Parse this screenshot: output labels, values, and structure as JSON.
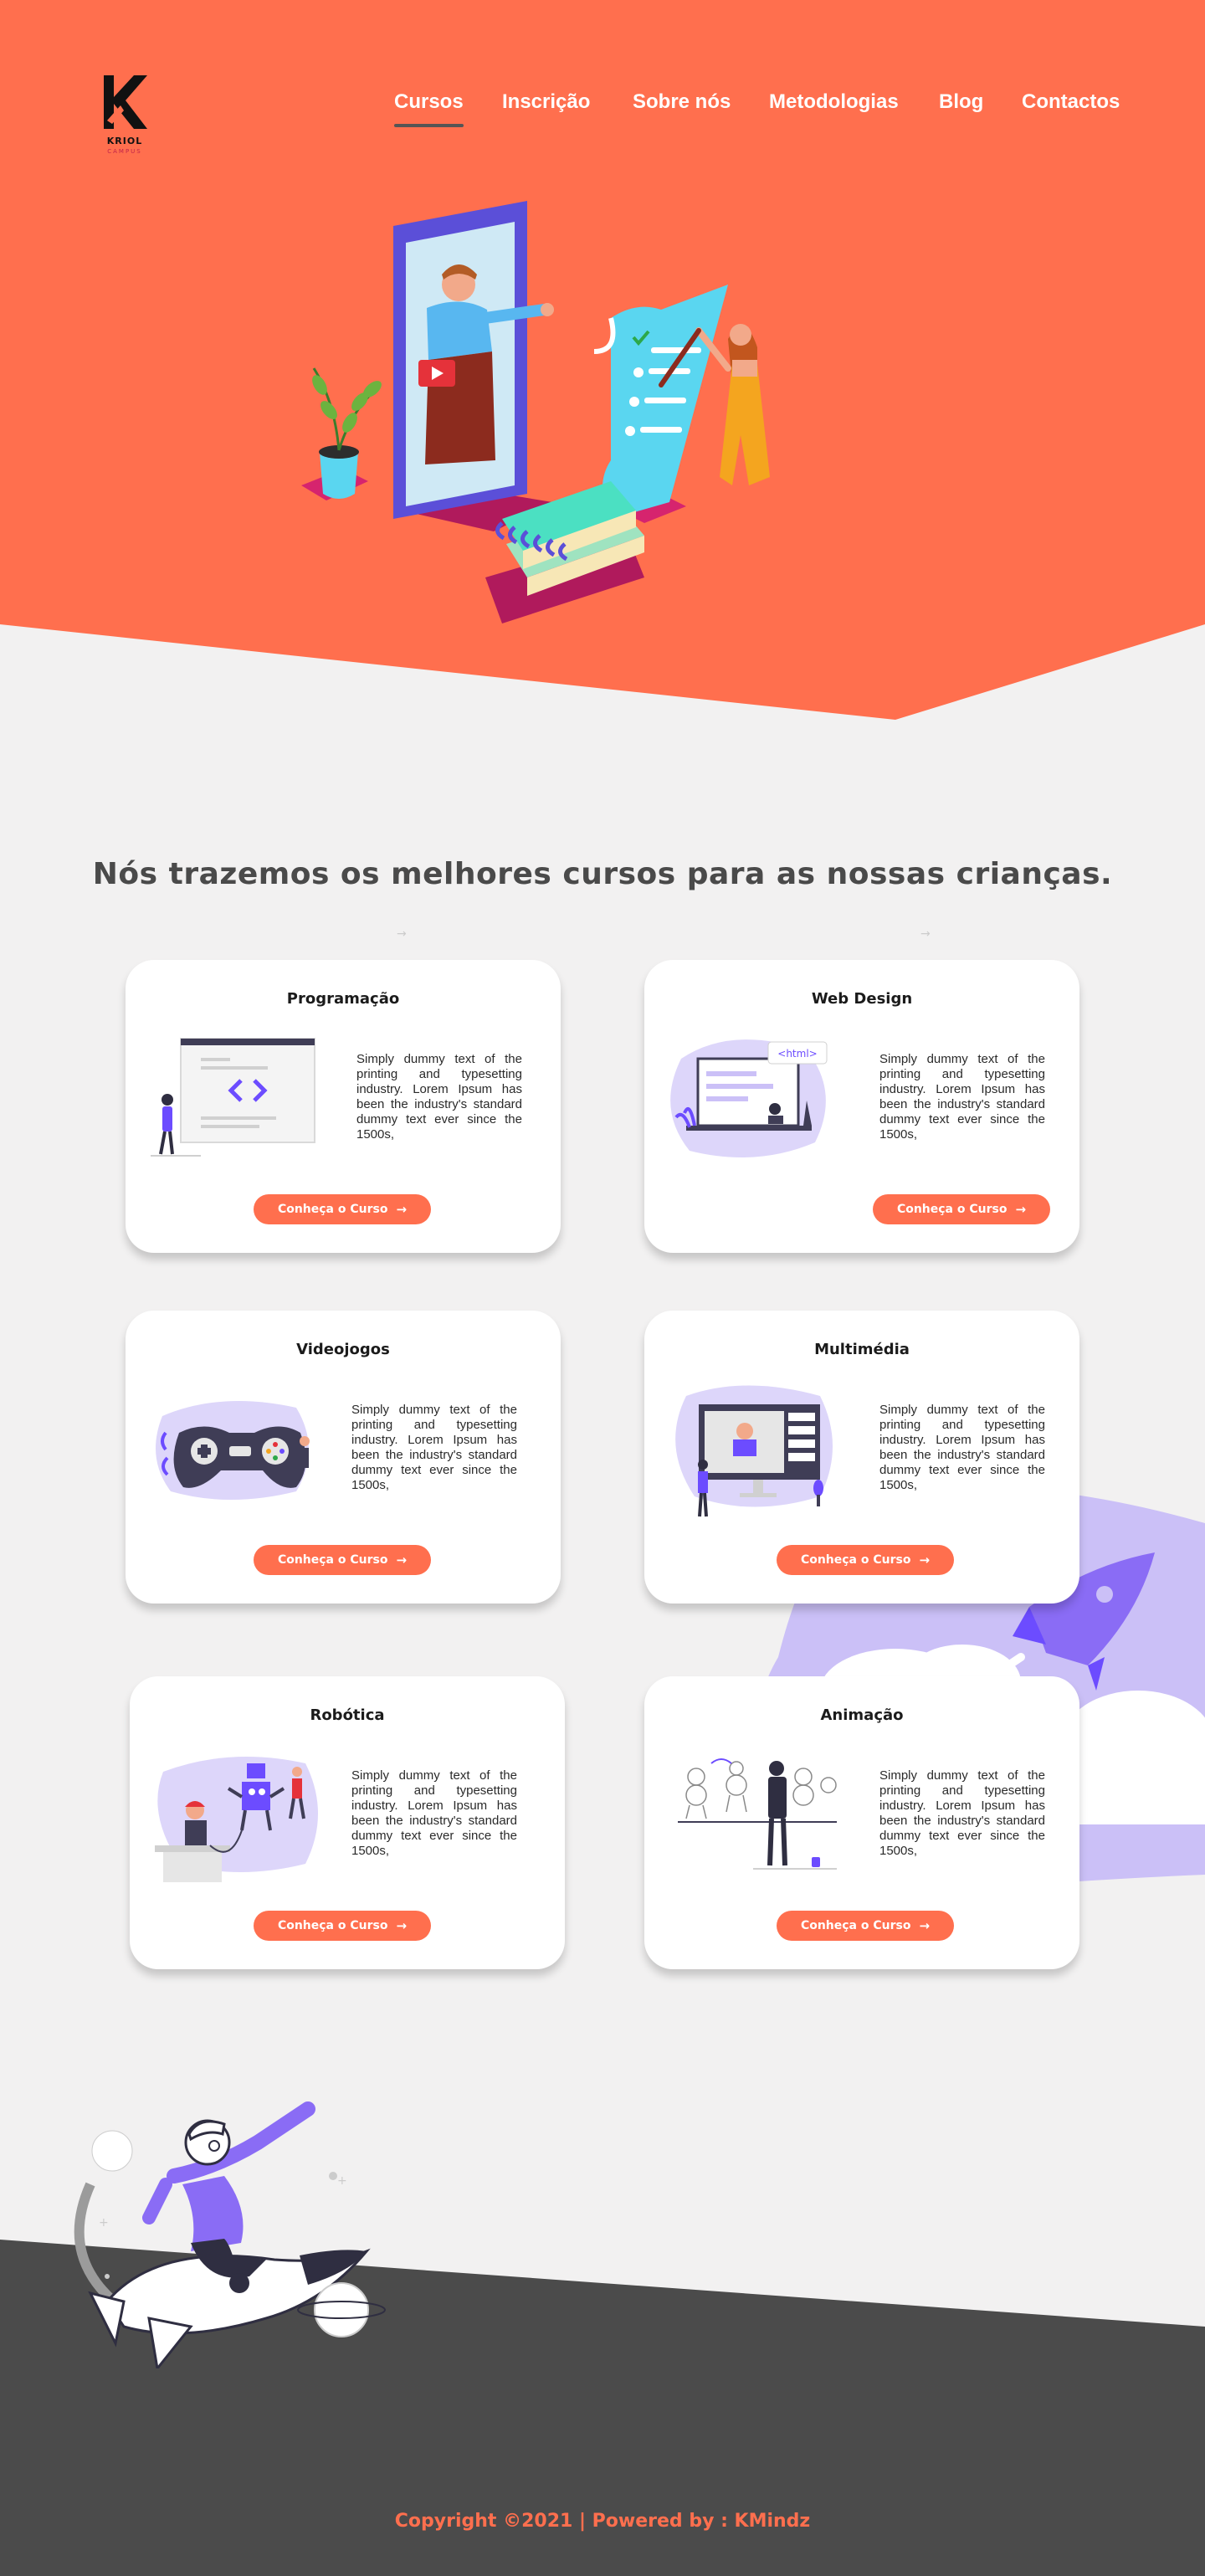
{
  "brand": {
    "name": "KRIOL",
    "sub": "CAMPUS",
    "colors": {
      "primary": "#ff6f4e",
      "dark": "#4b4b4b",
      "background": "#f2f1f1",
      "accent_purple": "#6c4cff"
    }
  },
  "nav": {
    "items": [
      {
        "label": "Cursos",
        "active": true
      },
      {
        "label": "Inscrição",
        "active": false
      },
      {
        "label": "Sobre nós",
        "active": false
      },
      {
        "label": "Metodologias",
        "active": false
      },
      {
        "label": "Blog",
        "active": false
      },
      {
        "label": "Contactos",
        "active": false
      }
    ]
  },
  "section": {
    "title": "Nós trazemos os melhores cursos para as nossas crianças."
  },
  "courses": [
    {
      "title": "Programação",
      "text": "Simply dummy text of the printing and typesetting industry. Lorem Ipsum has been the industry's standard dummy text ever since the 1500s,",
      "button": "Conheça o Curso",
      "icon": "programming-illustration"
    },
    {
      "title": "Web Design",
      "text": "Simply dummy text of the printing and typesetting industry. Lorem Ipsum has been the industry's standard dummy text ever since the 1500s,",
      "button": "Conheça o Curso",
      "icon": "web-design-illustration",
      "illus_label": "<html>"
    },
    {
      "title": "Videojogos",
      "text": "Simply dummy text of the printing and typesetting industry. Lorem Ipsum has been the industry's standard dummy text ever since the 1500s,",
      "button": "Conheça o Curso",
      "icon": "gamepad-illustration"
    },
    {
      "title": "Multimédia",
      "text": "Simply dummy text of the printing and typesetting industry. Lorem Ipsum has been the industry's standard dummy text ever since the 1500s,",
      "button": "Conheça o Curso",
      "icon": "multimedia-illustration"
    },
    {
      "title": "Robótica",
      "text": "Simply dummy text of the printing and typesetting industry. Lorem Ipsum has been the industry's standard dummy text ever since the 1500s,",
      "button": "Conheça o Curso",
      "icon": "robotics-illustration"
    },
    {
      "title": "Animação",
      "text": "Simply dummy text of the printing and typesetting industry. Lorem Ipsum has been the industry's standard dummy text ever since the 1500s,",
      "button": "Conheça o Curso",
      "icon": "animation-illustration"
    }
  ],
  "footer": {
    "copyright": "Copyright ©2021 | Powered by : KMindz"
  }
}
